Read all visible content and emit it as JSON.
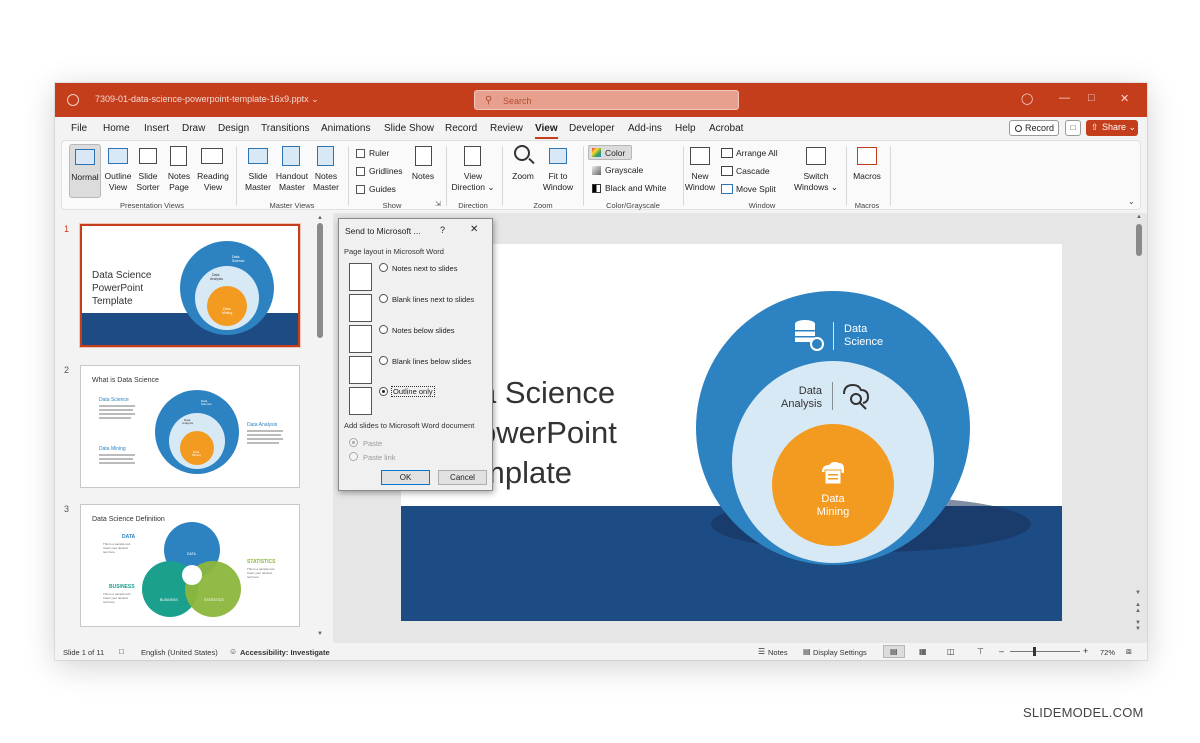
{
  "title_bar": {
    "doc_title": "7309-01-data-science-powerpoint-template-16x9.pptx ⌄",
    "search_placeholder": "Search"
  },
  "menu": {
    "tabs": [
      "File",
      "Home",
      "Insert",
      "Draw",
      "Design",
      "Transitions",
      "Animations",
      "Slide Show",
      "Record",
      "Review",
      "View",
      "Developer",
      "Add-ins",
      "Help",
      "Acrobat"
    ],
    "active_tab": "View",
    "record_label": "Record",
    "share_label": "Share ⌄"
  },
  "ribbon": {
    "presentation_views": {
      "label": "Presentation Views",
      "normal": "Normal",
      "outline_view": [
        "Outline",
        "View"
      ],
      "slide_sorter": [
        "Slide",
        "Sorter"
      ],
      "notes_page": [
        "Notes",
        "Page"
      ],
      "reading_view": [
        "Reading",
        "View"
      ]
    },
    "master_views": {
      "label": "Master Views",
      "slide_master": [
        "Slide",
        "Master"
      ],
      "handout_master": [
        "Handout",
        "Master"
      ],
      "notes_master": [
        "Notes",
        "Master"
      ]
    },
    "show": {
      "label": "Show",
      "ruler": "Ruler",
      "gridlines": "Gridlines",
      "guides": "Guides",
      "notes": "Notes"
    },
    "direction": {
      "label": "Direction",
      "text_direction": [
        "View",
        "Direction ⌄"
      ]
    },
    "zoom": {
      "label": "Zoom",
      "zoom": "Zoom",
      "fit_to_window": [
        "Fit to",
        "Window"
      ]
    },
    "color_grayscale": {
      "label": "Color/Grayscale",
      "color": "Color",
      "grayscale": "Grayscale",
      "black_and_white": "Black and White"
    },
    "window": {
      "label": "Window",
      "new_window": [
        "New",
        "Window"
      ],
      "arrange_all": "Arrange All",
      "cascade": "Cascade",
      "move_split": "Move Split",
      "switch_windows": [
        "Switch",
        "Windows ⌄"
      ]
    },
    "macros": {
      "label": "Macros",
      "macros": "Macros"
    }
  },
  "thumbnails": [
    {
      "number": "1",
      "title": [
        "Data Science",
        "PowerPoint",
        "Template"
      ],
      "circle_labels": [
        "Data",
        "Science",
        "Data",
        "Analysis",
        "Data",
        "Mining"
      ]
    },
    {
      "number": "2",
      "title": "What is Data Science",
      "left_headings": [
        "Data Science",
        "Data Mining"
      ],
      "right_heading": "Data Analysis",
      "circle_labels": [
        "Data",
        "Science",
        "Data",
        "Analysis",
        "Data",
        "Mining"
      ]
    },
    {
      "number": "3",
      "title": "Data Science Definition",
      "labels": [
        "DATA",
        "STATISTICS",
        "BUSINESS"
      ],
      "circle_labels": [
        "DATA",
        "BUSINESS",
        "STATISTICS"
      ],
      "sample_text": [
        "This is a sample text.",
        "Insert your desired",
        "text here."
      ]
    }
  ],
  "main_slide": {
    "title_lines": [
      "a Science",
      "owerPoint",
      "mplate"
    ],
    "outer_label": [
      "Data",
      "Science"
    ],
    "middle_label": [
      "Data",
      "Analysis"
    ],
    "inner_label": [
      "Data",
      "Mining"
    ]
  },
  "dialog": {
    "title": "Send to Microsoft ...",
    "help": "?",
    "close": "✕",
    "layout_section": "Page layout in Microsoft Word",
    "options": [
      {
        "label": "Notes next to slides",
        "selected": false
      },
      {
        "label": "Blank lines next to slides",
        "selected": false
      },
      {
        "label": "Notes below slides",
        "selected": false
      },
      {
        "label": "Blank lines below slides",
        "selected": false
      },
      {
        "label": "Outline only",
        "selected": true
      }
    ],
    "add_section": "Add slides to Microsoft Word document",
    "paste": "Paste",
    "paste_link": "Paste link",
    "ok": "OK",
    "cancel": "Cancel"
  },
  "status_bar": {
    "slide_count": "Slide 1 of 11",
    "language": "English (United States)",
    "accessibility": "Accessibility: Investigate",
    "notes": "Notes",
    "display_settings": "Display Settings",
    "zoom_level": "72%"
  },
  "watermark": "SLIDEMODEL.COM",
  "colors": {
    "title_bar": "#c43e1c",
    "circle_outer": "#2d83c1",
    "circle_middle": "#d8e9f6",
    "circle_inner": "#f39a21",
    "slide_band": "#1d4b84"
  }
}
